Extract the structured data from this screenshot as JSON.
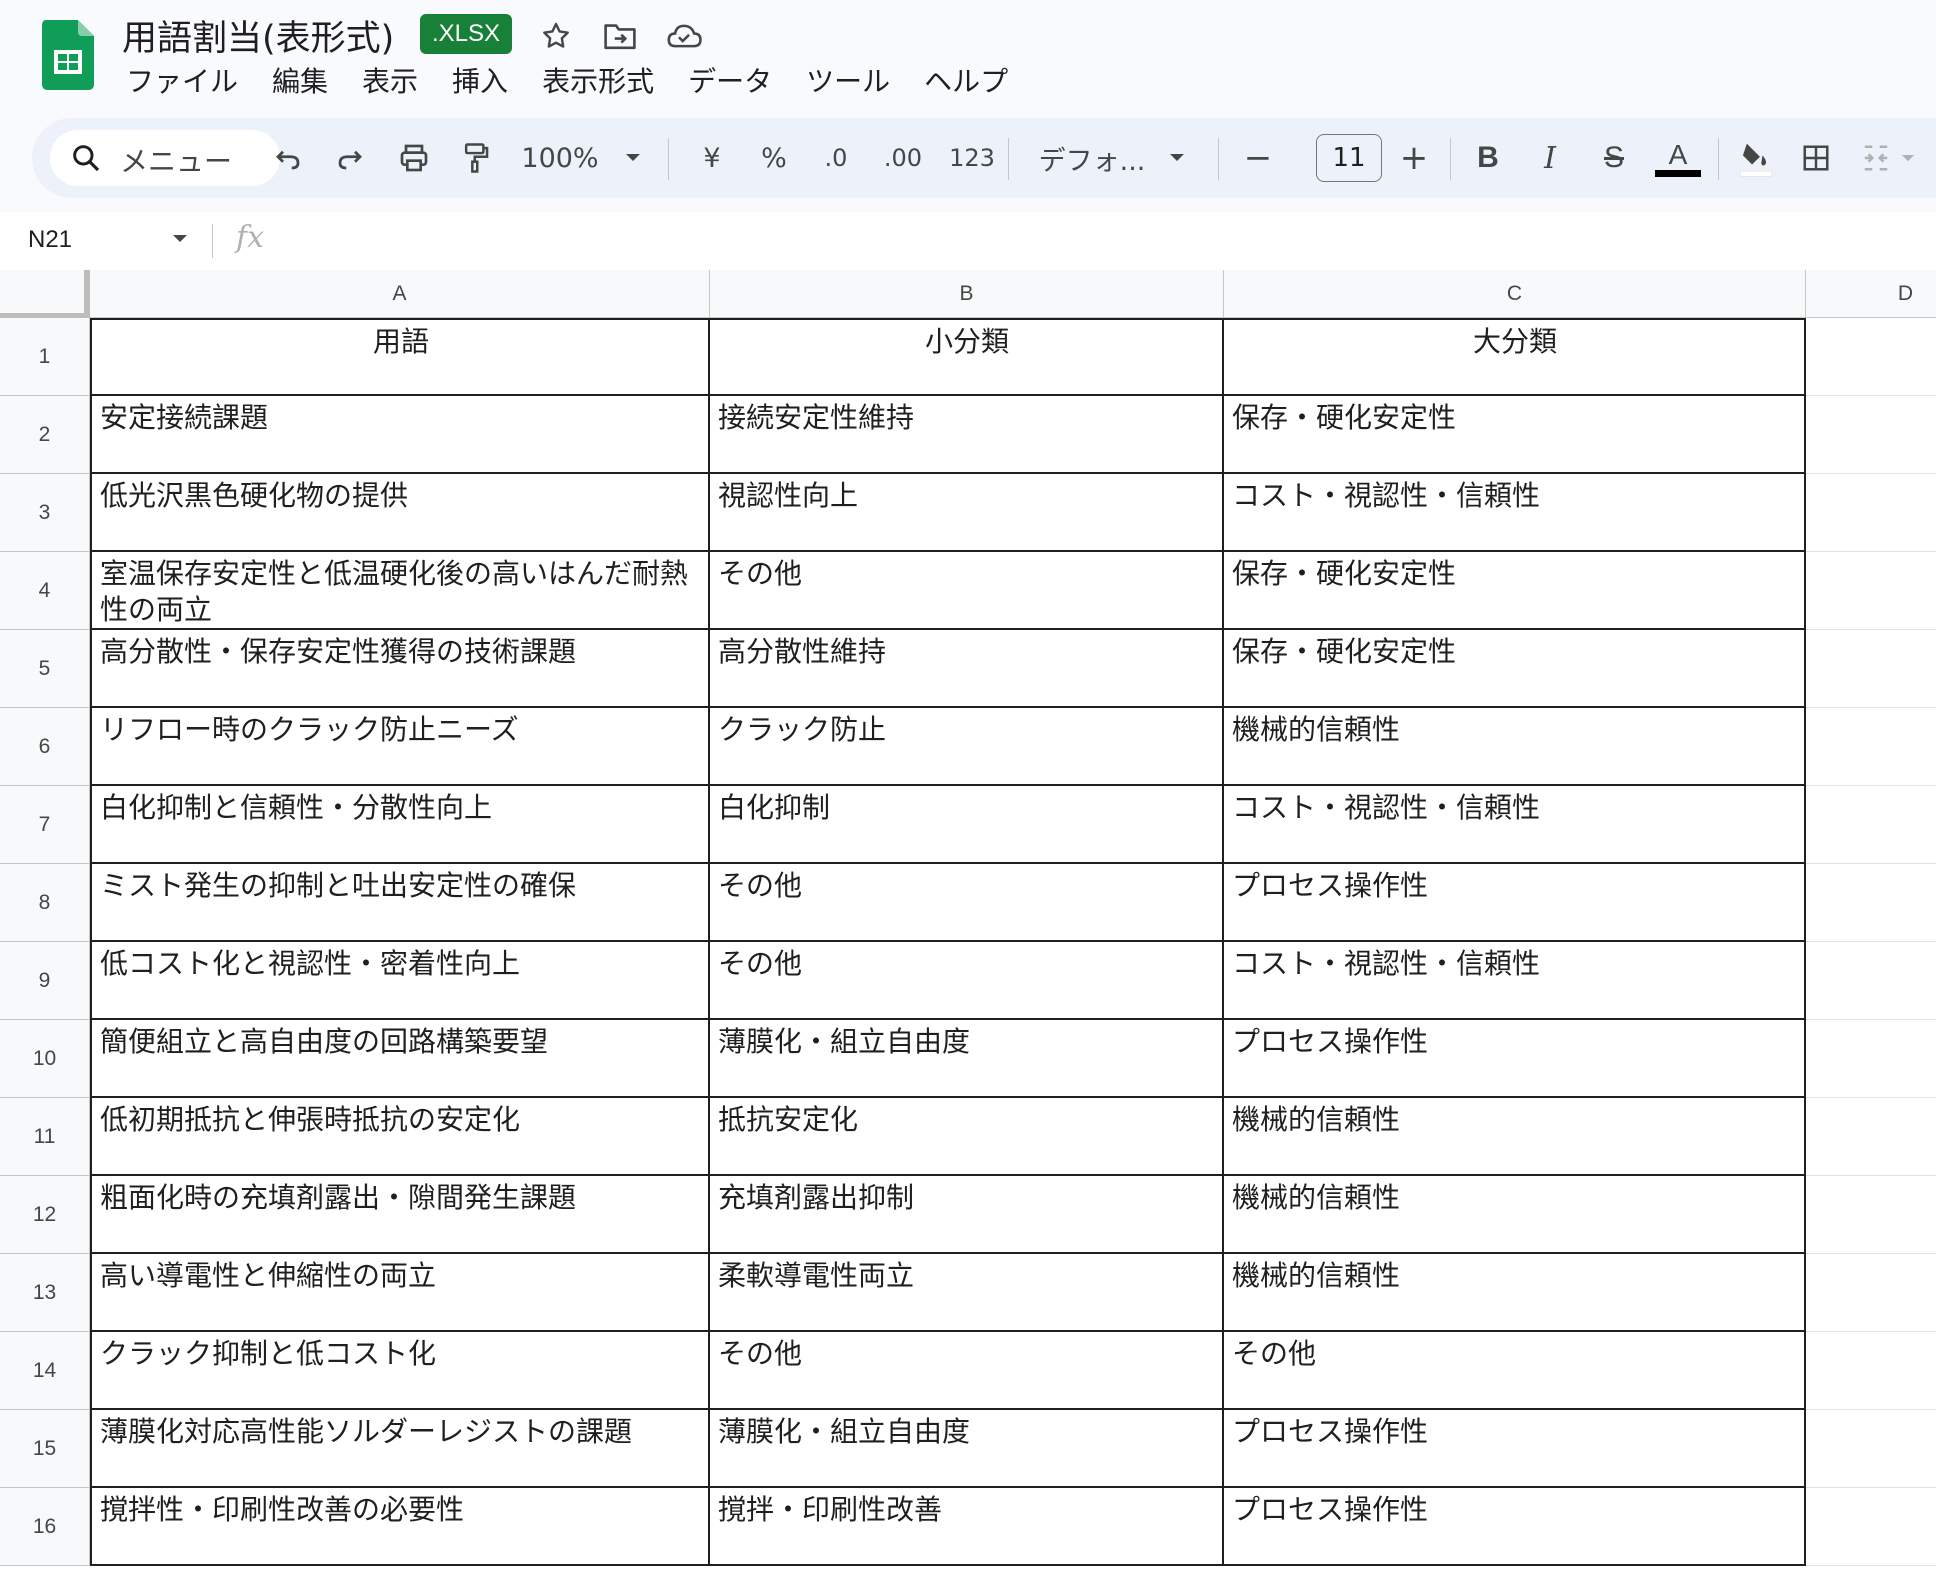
{
  "title_bar": {
    "doc_title": "用語割当(表形式)",
    "file_badge": ".XLSX",
    "icons": [
      "star-icon",
      "move-to-folder-icon",
      "cloud-saved-icon"
    ]
  },
  "menu": [
    "ファイル",
    "編集",
    "表示",
    "挿入",
    "表示形式",
    "データ",
    "ツール",
    "ヘルプ"
  ],
  "toolbar": {
    "search_placeholder": "メニュー",
    "zoom": "100%",
    "currency": "¥",
    "percent": "%",
    "decrease_decimal": ".0",
    "increase_decimal": ".00",
    "number_format": "123",
    "font_family": "デフォ...",
    "font_size": "11",
    "minus": "−",
    "plus": "+",
    "bold": "B",
    "italic": "I",
    "strike": "S",
    "text_color": "A"
  },
  "formula_bar": {
    "cell_ref": "N21",
    "fx": "fx",
    "value": ""
  },
  "sheet": {
    "columns": [
      "A",
      "B",
      "C",
      "D"
    ],
    "header": [
      "用語",
      "小分類",
      "大分類"
    ],
    "rows": [
      {
        "n": "1"
      },
      {
        "n": "2",
        "a": "安定接続課題",
        "b": "接続安定性維持",
        "c": "保存・硬化安定性"
      },
      {
        "n": "3",
        "a": "低光沢黒色硬化物の提供",
        "b": "視認性向上",
        "c": "コスト・視認性・信頼性"
      },
      {
        "n": "4",
        "a": "室温保存安定性と低温硬化後の高いはんだ耐熱性の両立",
        "b": "その他",
        "c": "保存・硬化安定性"
      },
      {
        "n": "5",
        "a": "高分散性・保存安定性獲得の技術課題",
        "b": "高分散性維持",
        "c": "保存・硬化安定性"
      },
      {
        "n": "6",
        "a": "リフロー時のクラック防止ニーズ",
        "b": "クラック防止",
        "c": "機械的信頼性"
      },
      {
        "n": "7",
        "a": "白化抑制と信頼性・分散性向上",
        "b": "白化抑制",
        "c": "コスト・視認性・信頼性"
      },
      {
        "n": "8",
        "a": "ミスト発生の抑制と吐出安定性の確保",
        "b": "その他",
        "c": "プロセス操作性"
      },
      {
        "n": "9",
        "a": "低コスト化と視認性・密着性向上",
        "b": "その他",
        "c": "コスト・視認性・信頼性"
      },
      {
        "n": "10",
        "a": "簡便組立と高自由度の回路構築要望",
        "b": "薄膜化・組立自由度",
        "c": "プロセス操作性"
      },
      {
        "n": "11",
        "a": "低初期抵抗と伸張時抵抗の安定化",
        "b": "抵抗安定化",
        "c": "機械的信頼性"
      },
      {
        "n": "12",
        "a": "粗面化時の充填剤露出・隙間発生課題",
        "b": "充填剤露出抑制",
        "c": "機械的信頼性"
      },
      {
        "n": "13",
        "a": "高い導電性と伸縮性の両立",
        "b": "柔軟導電性両立",
        "c": "機械的信頼性"
      },
      {
        "n": "14",
        "a": "クラック抑制と低コスト化",
        "b": "その他",
        "c": "その他"
      },
      {
        "n": "15",
        "a": "薄膜化対応高性能ソルダーレジストの課題",
        "b": "薄膜化・組立自由度",
        "c": "プロセス操作性"
      },
      {
        "n": "16",
        "a": "撹拌性・印刷性改善の必要性",
        "b": "撹拌・印刷性改善",
        "c": "プロセス操作性"
      }
    ]
  },
  "colors": {
    "sheets_green": "#0f9d58",
    "badge_green": "#188038",
    "toolbar_bg": "#edf2fa"
  }
}
